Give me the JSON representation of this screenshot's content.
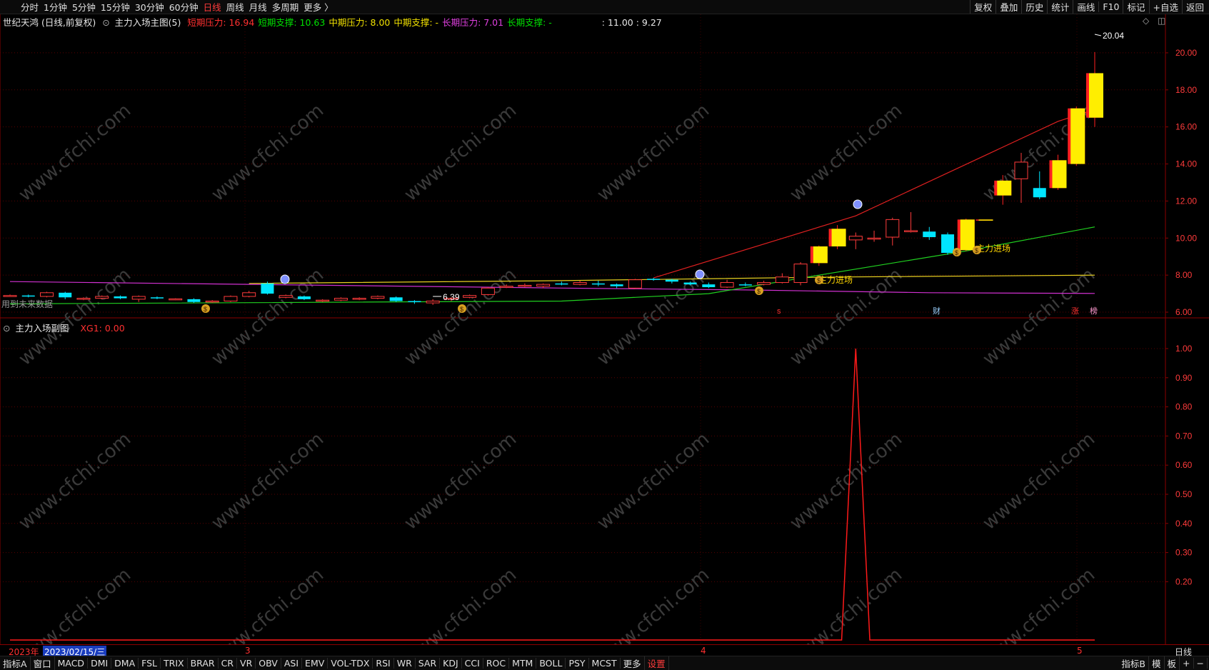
{
  "toolbar": {
    "left": [
      "分时",
      "1分钟",
      "5分钟",
      "15分钟",
      "30分钟",
      "60分钟",
      "日线",
      "周线",
      "月线",
      "多周期",
      "更多 〉"
    ],
    "active": "日线",
    "right": [
      "复权",
      "叠加",
      "历史",
      "统计",
      "画线",
      "F10",
      "标记",
      "+自选",
      "返回"
    ]
  },
  "main": {
    "stock": "世纪天鸿 (日线,前复权)",
    "indicator": "主力入场主图(5)",
    "stats": [
      {
        "label": "短期压力:",
        "value": "16.94",
        "color": "#ff3030"
      },
      {
        "label": "短期支撑:",
        "value": "10.63",
        "color": "#00e000"
      },
      {
        "label": "中期压力:",
        "value": "8.00",
        "color": "#f0e000"
      },
      {
        "label": "中期支撑:",
        "value": "-",
        "color": "#f0e000"
      },
      {
        "label": "长期压力:",
        "value": "7.01",
        "color": "#e040e0"
      },
      {
        "label": "长期支撑:",
        "value": "-",
        "color": "#00e000"
      }
    ],
    "extra": ": 11.00   : 9.27",
    "future_note": "用到未来数据",
    "max_label": "20.04",
    "min_label": "6.39",
    "signal_text": "主力进场",
    "markers": {
      "s": "s",
      "cai": "财",
      "zhang": "涨",
      "bang": "榜"
    }
  },
  "sub": {
    "title": "主力入场副图",
    "value_label": "XG1: 0.00"
  },
  "watermark": "www.cfchi.com",
  "dates": {
    "year": "2023年",
    "cursor": "2023/02/15/三",
    "months": [
      "3",
      "4",
      "5"
    ],
    "period": "日线"
  },
  "indicators": [
    "指标A",
    "窗口",
    "MACD",
    "DMI",
    "DMA",
    "FSL",
    "TRIX",
    "BRAR",
    "CR",
    "VR",
    "OBV",
    "ASI",
    "EMV",
    "VOL-TDX",
    "RSI",
    "WR",
    "SAR",
    "KDJ",
    "CCI",
    "ROC",
    "MTM",
    "BOLL",
    "PSY",
    "MCST",
    "更多",
    "设置"
  ],
  "indicators_right": [
    "指标B",
    "模",
    "板",
    "+",
    "−"
  ],
  "chart_data": {
    "type": "candlestick",
    "y_ticks_main": [
      "20.00",
      "18.00",
      "16.00",
      "14.00",
      "12.00",
      "10.00",
      "8.00",
      "6.00"
    ],
    "y_range_main": [
      5.5,
      21.0
    ],
    "y_ticks_sub": [
      "1.00",
      "0.90",
      "0.80",
      "0.70",
      "0.60",
      "0.50",
      "0.40",
      "0.30",
      "0.20"
    ],
    "y_range_sub": [
      0,
      1.0
    ],
    "candles": [
      [
        6.9,
        6.9,
        6.95,
        6.85
      ],
      [
        6.9,
        6.88,
        6.95,
        6.8
      ],
      [
        6.85,
        7.05,
        7.1,
        6.8
      ],
      [
        7.05,
        6.8,
        7.1,
        6.7
      ],
      [
        6.7,
        6.75,
        6.8,
        6.65
      ],
      [
        6.75,
        6.85,
        6.9,
        6.7
      ],
      [
        6.85,
        6.75,
        6.9,
        6.7
      ],
      [
        6.7,
        6.85,
        6.9,
        6.55
      ],
      [
        6.8,
        6.75,
        6.85,
        6.7
      ],
      [
        6.7,
        6.72,
        6.75,
        6.65
      ],
      [
        6.7,
        6.55,
        6.75,
        6.5
      ],
      [
        6.55,
        6.6,
        6.65,
        6.5
      ],
      [
        6.6,
        6.85,
        6.9,
        6.55
      ],
      [
        6.85,
        7.05,
        7.15,
        6.8
      ],
      [
        7.55,
        7.0,
        7.65,
        6.95
      ],
      [
        6.8,
        6.9,
        6.95,
        6.75
      ],
      [
        6.85,
        6.7,
        6.9,
        6.65
      ],
      [
        6.6,
        6.65,
        6.7,
        6.55
      ],
      [
        6.65,
        6.75,
        6.8,
        6.6
      ],
      [
        6.7,
        6.75,
        6.8,
        6.65
      ],
      [
        6.75,
        6.85,
        6.9,
        6.7
      ],
      [
        6.8,
        6.6,
        6.85,
        6.55
      ],
      [
        6.6,
        6.55,
        6.65,
        6.45
      ],
      [
        6.5,
        6.6,
        6.7,
        6.39
      ],
      [
        6.7,
        6.75,
        6.8,
        6.6
      ],
      [
        6.8,
        6.9,
        6.95,
        6.75
      ],
      [
        6.95,
        7.3,
        7.35,
        6.9
      ],
      [
        7.35,
        7.4,
        7.5,
        7.3
      ],
      [
        7.4,
        7.45,
        7.55,
        7.35
      ],
      [
        7.4,
        7.5,
        7.55,
        7.3
      ],
      [
        7.55,
        7.5,
        7.65,
        7.45
      ],
      [
        7.5,
        7.6,
        7.7,
        7.45
      ],
      [
        7.55,
        7.5,
        7.7,
        7.4
      ],
      [
        7.5,
        7.4,
        7.55,
        7.3
      ],
      [
        7.3,
        7.75,
        7.8,
        7.25
      ],
      [
        7.8,
        7.75,
        7.85,
        7.7
      ],
      [
        7.75,
        7.65,
        7.8,
        7.55
      ],
      [
        7.6,
        7.5,
        7.65,
        7.45
      ],
      [
        7.5,
        7.35,
        7.6,
        7.3
      ],
      [
        7.35,
        7.6,
        7.75,
        7.3
      ],
      [
        7.5,
        7.45,
        7.6,
        7.4
      ],
      [
        7.5,
        7.6,
        7.7,
        7.45
      ],
      [
        7.6,
        7.9,
        8.1,
        7.55
      ],
      [
        7.6,
        8.6,
        8.7,
        7.45
      ],
      [
        8.65,
        9.55,
        9.6,
        8.5
      ],
      [
        9.55,
        10.5,
        10.7,
        9.4
      ],
      [
        9.9,
        10.1,
        10.3,
        9.4
      ],
      [
        10.0,
        10.0,
        10.4,
        9.8
      ],
      [
        10.05,
        11.0,
        11.1,
        9.6
      ],
      [
        10.4,
        10.4,
        11.4,
        10.3
      ],
      [
        10.35,
        10.05,
        10.6,
        9.9
      ],
      [
        10.2,
        9.2,
        10.3,
        9.1
      ],
      [
        9.35,
        11.0,
        11.05,
        9.3
      ],
      [
        11.0,
        11.0,
        11.0,
        11.0
      ],
      [
        12.3,
        13.1,
        13.4,
        11.8
      ],
      [
        13.2,
        14.1,
        14.6,
        11.9
      ],
      [
        12.7,
        12.2,
        13.6,
        12.1
      ],
      [
        12.7,
        14.2,
        14.5,
        12.6
      ],
      [
        14.0,
        17.0,
        17.1,
        13.9
      ],
      [
        16.5,
        18.9,
        20.04,
        16.0
      ]
    ],
    "big_candles": [
      44,
      45,
      52,
      53,
      54,
      57,
      58,
      59
    ],
    "support_green": [
      [
        0,
        6.45
      ],
      [
        30,
        6.6
      ],
      [
        38,
        7.0
      ],
      [
        44,
        8.0
      ],
      [
        52,
        9.3
      ],
      [
        59,
        10.6
      ]
    ],
    "resist_red": [
      [
        35,
        7.85
      ],
      [
        46,
        11.2
      ],
      [
        57,
        16.3
      ],
      [
        59,
        16.94
      ]
    ],
    "mid_yellow": [
      [
        13,
        7.55
      ],
      [
        30,
        7.7
      ],
      [
        45,
        7.9
      ],
      [
        59,
        8.0
      ]
    ],
    "long_magenta": [
      [
        0,
        7.65
      ],
      [
        30,
        7.3
      ],
      [
        40,
        7.2
      ],
      [
        50,
        7.05
      ],
      [
        59,
        7.01
      ]
    ],
    "xg1_spike_index": 46
  }
}
